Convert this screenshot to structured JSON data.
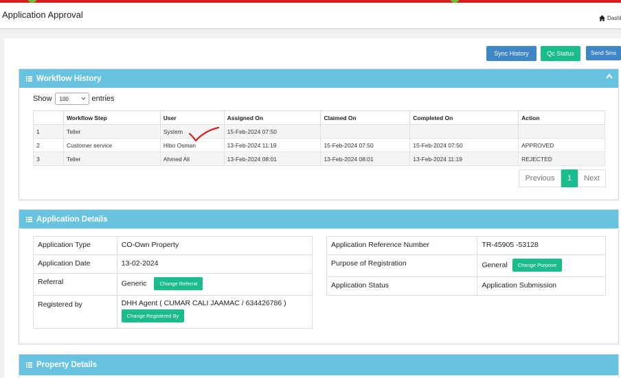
{
  "header": {
    "title": "Application Approval",
    "breadcrumb": "Dashl"
  },
  "toolbar": {
    "sync_history": "Sync History",
    "qc_status": "Qc Status",
    "send_sms": "Send Sms"
  },
  "workflow": {
    "title": "Workflow History",
    "show_label": "Show",
    "entries_value": "100",
    "entries_label": "entries",
    "columns": [
      "",
      "Workflow Step",
      "User",
      "Assigned On",
      "Claimed On",
      "Completed On",
      "Action"
    ],
    "rows": [
      [
        "1",
        "Teller",
        "System",
        "15-Feb-2024 07:50",
        "",
        "",
        ""
      ],
      [
        "2",
        "Customer service",
        "Hibo Osman",
        "13-Feb-2024 11:19",
        "15-Feb-2024 07:50",
        "15-Feb-2024 07:50",
        "APPROVED"
      ],
      [
        "3",
        "Teller",
        "Ahmed Ali",
        "13-Feb-2024 08:01",
        "13-Feb-2024 08:01",
        "13-Feb-2024 11:19",
        "REJECTED"
      ]
    ],
    "pager": {
      "previous": "Previous",
      "page": "1",
      "next": "Next"
    }
  },
  "details": {
    "title": "Application Details",
    "left": {
      "application_type_label": "Application Type",
      "application_type": "CO-Own Property",
      "application_date_label": "Application Date",
      "application_date": "13-02-2024",
      "referral_label": "Referral",
      "referral": "Generic",
      "change_referral": "Change Referral",
      "registered_by_label": "Registered by",
      "registered_by": "DHH Agent ( CUMAR CALI JAAMAC / 634426786 )",
      "change_registered_by": "Change Registered By"
    },
    "right": {
      "ref_label": "Application Reference Number",
      "ref": "TR-45905 -53128",
      "purpose_label": "Purpose of Registration",
      "purpose": "General",
      "change_purpose": "Change Purpose",
      "status_label": "Application Status",
      "status": "Application Submission"
    }
  },
  "property": {
    "title": "Property Details"
  },
  "colors": {
    "panel_header": "#67c3e0",
    "accent_green": "#1bbc8c",
    "accent_blue": "#3f86c7",
    "approved": "#2aa55a",
    "rejected": "#e04a3a"
  }
}
